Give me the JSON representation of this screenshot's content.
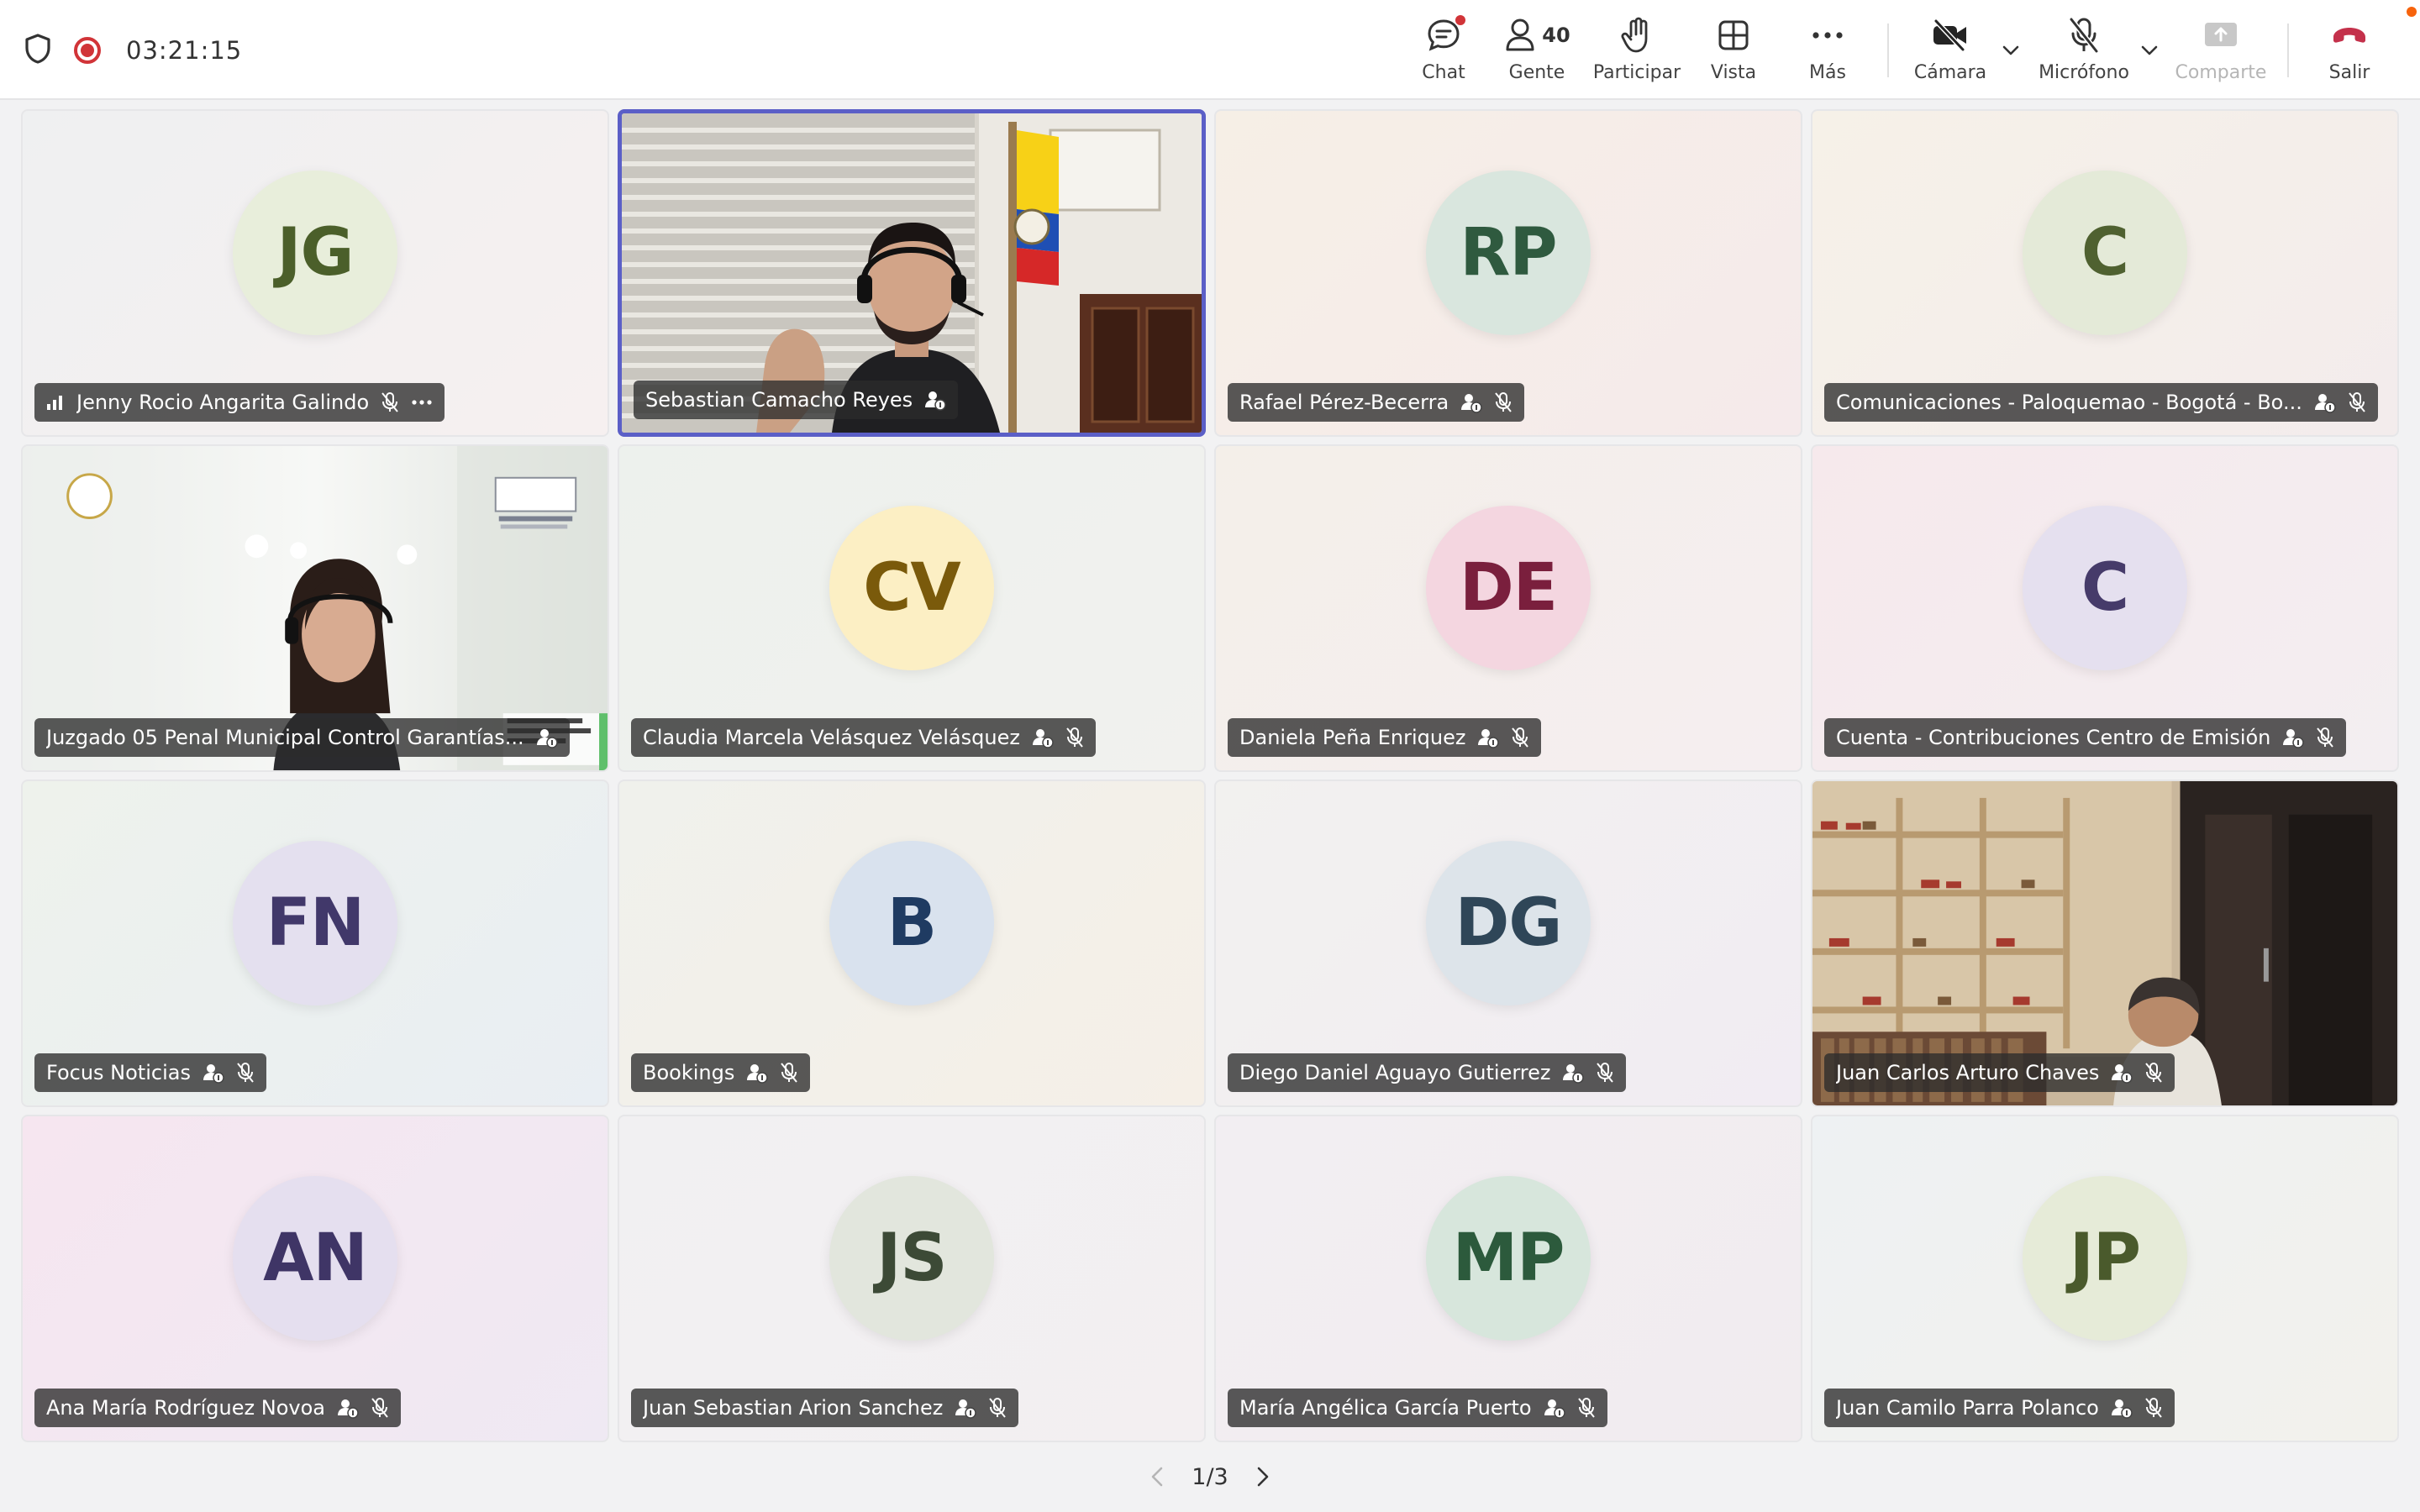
{
  "header": {
    "timer": "03:21:15",
    "chat_label": "Chat",
    "people_label": "Gente",
    "people_count": "40",
    "raise_label": "Participar",
    "view_label": "Vista",
    "more_label": "Más",
    "camera_label": "Cámara",
    "mic_label": "Micrófono",
    "share_label": "Comparte",
    "leave_label": "Salir"
  },
  "colors": {
    "accent": "#5b5fc7",
    "record": "#d13438",
    "leave": "#c4314b",
    "notify": "#f7630c"
  },
  "tiles": [
    {
      "name": "Jenny Rocio Angarita Galindo",
      "initials": "JG",
      "bg": "#f3f3f4",
      "avatar_bg": "#e8eedb",
      "avatar_fg": "#4b5f2a"
    },
    {
      "name": "Sebastian Camacho Reyes",
      "initials": "",
      "video": true
    },
    {
      "name": "Rafael Pérez-Becerra",
      "initials": "RP",
      "bg": "#f6efe8",
      "avatar_bg": "#d9e6de",
      "avatar_fg": "#2f5a3f"
    },
    {
      "name": "Comunicaciones - Paloquemao - Bogotá - Bo...",
      "initials": "C",
      "bg": "#f5f1ea",
      "avatar_bg": "#e4ead8",
      "avatar_fg": "#4f6130"
    },
    {
      "name": "Juzgado 05 Penal Municipal Control Garantías...",
      "initials": "",
      "video": true
    },
    {
      "name": "Claudia Marcela Velásquez Velásquez",
      "initials": "CV",
      "bg": "#eef1ee",
      "avatar_bg": "#fcefc4",
      "avatar_fg": "#7a5a0b"
    },
    {
      "name": "Daniela Peña Enriquez",
      "initials": "DE",
      "bg": "#f5efed",
      "avatar_bg": "#f4d6e0",
      "avatar_fg": "#7a1f3d"
    },
    {
      "name": "Cuenta - Contribuciones Centro de Emisión",
      "initials": "C",
      "bg": "#f6ecee",
      "avatar_bg": "#e5e0ef",
      "avatar_fg": "#463b6a"
    },
    {
      "name": "Focus Noticias",
      "initials": "FN",
      "bg": "#eef2ef",
      "avatar_bg": "#e4e0ef",
      "avatar_fg": "#41386a"
    },
    {
      "name": "Bookings",
      "initials": "B",
      "bg": "#f3f1ea",
      "avatar_bg": "#d9e2ee",
      "avatar_fg": "#1f3b62"
    },
    {
      "name": "Diego Daniel Aguayo Gutierrez",
      "initials": "DG",
      "bg": "#f1eff3",
      "avatar_bg": "#dde4ea",
      "avatar_fg": "#2f4658"
    },
    {
      "name": "Juan Carlos Arturo Chaves",
      "initials": "",
      "video": true
    },
    {
      "name": "Ana María Rodríguez Novoa",
      "initials": "AN",
      "bg": "#f7e9f1",
      "avatar_bg": "#e5dfef",
      "avatar_fg": "#3f3566"
    },
    {
      "name": "Juan Sebastian Arion Sanchez",
      "initials": "JS",
      "bg": "#f1f0f2",
      "avatar_bg": "#e2e6dd",
      "avatar_fg": "#3c4a36"
    },
    {
      "name": "María Angélica García Puerto",
      "initials": "MP",
      "bg": "#f2eef1",
      "avatar_bg": "#d7e6dc",
      "avatar_fg": "#2c5a3c"
    },
    {
      "name": "Juan Camilo Parra Polanco",
      "initials": "JP",
      "bg": "#f0f1ec",
      "avatar_bg": "#e6ebd8",
      "avatar_fg": "#4a5a2c"
    }
  ],
  "pager": {
    "text": "1/3"
  }
}
